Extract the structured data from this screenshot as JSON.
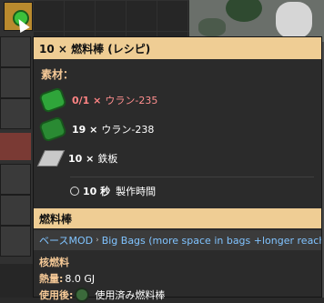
{
  "tooltip": {
    "title": "10 × 燃料棒 (レシピ)",
    "ingredients_label": "素材：",
    "ingredients": [
      {
        "amount": "0/1 ×",
        "name": "ウラン-235",
        "icon": "uranium-235-icon",
        "insufficient": true
      },
      {
        "amount": "19 ×",
        "name": "ウラン-238",
        "icon": "uranium-238-icon",
        "insufficient": false
      },
      {
        "amount": "10 ×",
        "name": "鉄板",
        "icon": "iron-plate-icon",
        "insufficient": false
      }
    ],
    "time_value": "10 秒",
    "time_label": "製作時間",
    "item_title": "燃料棒",
    "mod_base": "ベースMOD",
    "mod_separator": "›",
    "mod_name": "Big Bags (more space in bags +longer reach)",
    "fuel_category": "核燃料",
    "fuel_value_label": "熱量:",
    "fuel_value": "8.0 GJ",
    "burnt_result_label": "使用後:",
    "burnt_result": "使用済み燃料棒"
  },
  "colors": {
    "header_bg": "#efcd94",
    "label_color": "#f4c896",
    "warning": "#ff8484",
    "link": "#80c3ff"
  }
}
